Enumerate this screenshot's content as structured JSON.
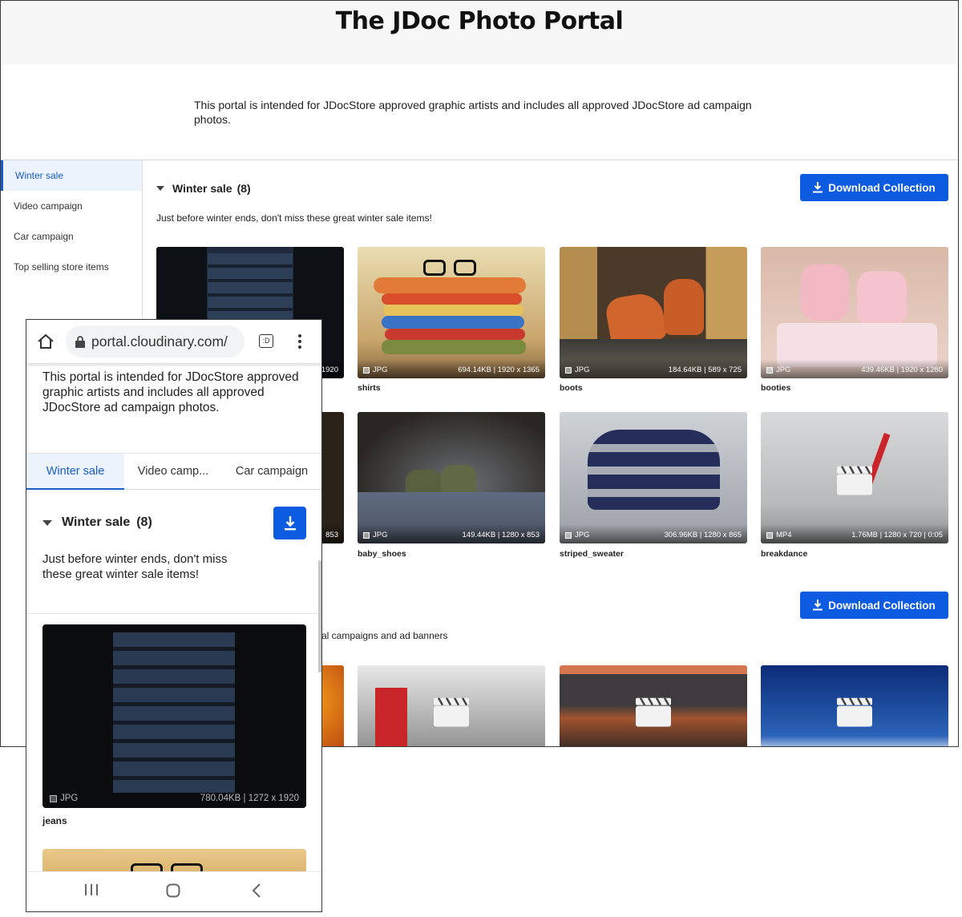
{
  "portal": {
    "title": "The JDoc Photo Portal",
    "intro": "This portal is intended for JDocStore approved graphic artists and includes all approved JDocStore ad campaign photos."
  },
  "sidebar": {
    "items": [
      {
        "label": "Winter sale",
        "active": true
      },
      {
        "label": "Video campaign"
      },
      {
        "label": "Car campaign"
      },
      {
        "label": "Top selling store items"
      }
    ]
  },
  "section1": {
    "title": "Winter sale",
    "count": "(8)",
    "description": "Just before winter ends, don't miss these great winter sale items!",
    "download_label": "Download Collection",
    "cards": [
      {
        "name": "jeans",
        "format": "JPG",
        "info": "780.04KB | 1272 x 1920",
        "partial_info": "1920"
      },
      {
        "name": "shirts",
        "format": "JPG",
        "info": "694.14KB | 1920 x 1365"
      },
      {
        "name": "boots",
        "format": "JPG",
        "info": "184.64KB | 589 x 725"
      },
      {
        "name": "booties",
        "format": "JPG",
        "info": "439.46KB | 1920 x 1280"
      },
      {
        "name": "",
        "format": "",
        "info": "",
        "partial_info": "853"
      },
      {
        "name": "baby_shoes",
        "format": "JPG",
        "info": "149.44KB | 1280 x 853"
      },
      {
        "name": "striped_sweater",
        "format": "JPG",
        "info": "306.96KB | 1280 x 865"
      },
      {
        "name": "breakdance",
        "format": "MP4",
        "info": "1.76MB | 1280 x 720 | 0:05"
      }
    ]
  },
  "section2": {
    "download_label": "Download Collection",
    "description_partial": "al campaigns and ad banners"
  },
  "mobile": {
    "url": "portal.cloudinary.com/",
    "tabs_icon_text": ":D",
    "intro": "This portal is intended for JDocStore approved graphic artists and includes all approved JDocStore ad campaign photos.",
    "tabs": [
      {
        "label": "Winter sale",
        "active": true
      },
      {
        "label": "Video camp..."
      },
      {
        "label": "Car campaign"
      }
    ],
    "section_title": "Winter sale",
    "section_count": "(8)",
    "description": "Just before winter ends, don't miss these great winter sale items!",
    "card": {
      "name": "jeans",
      "format": "JPG",
      "info": "780.04KB | 1272 x 1920"
    }
  },
  "colors": {
    "accent": "#0d5be0",
    "active_text": "#1a5dc9",
    "active_bg": "#ecf3fd"
  }
}
